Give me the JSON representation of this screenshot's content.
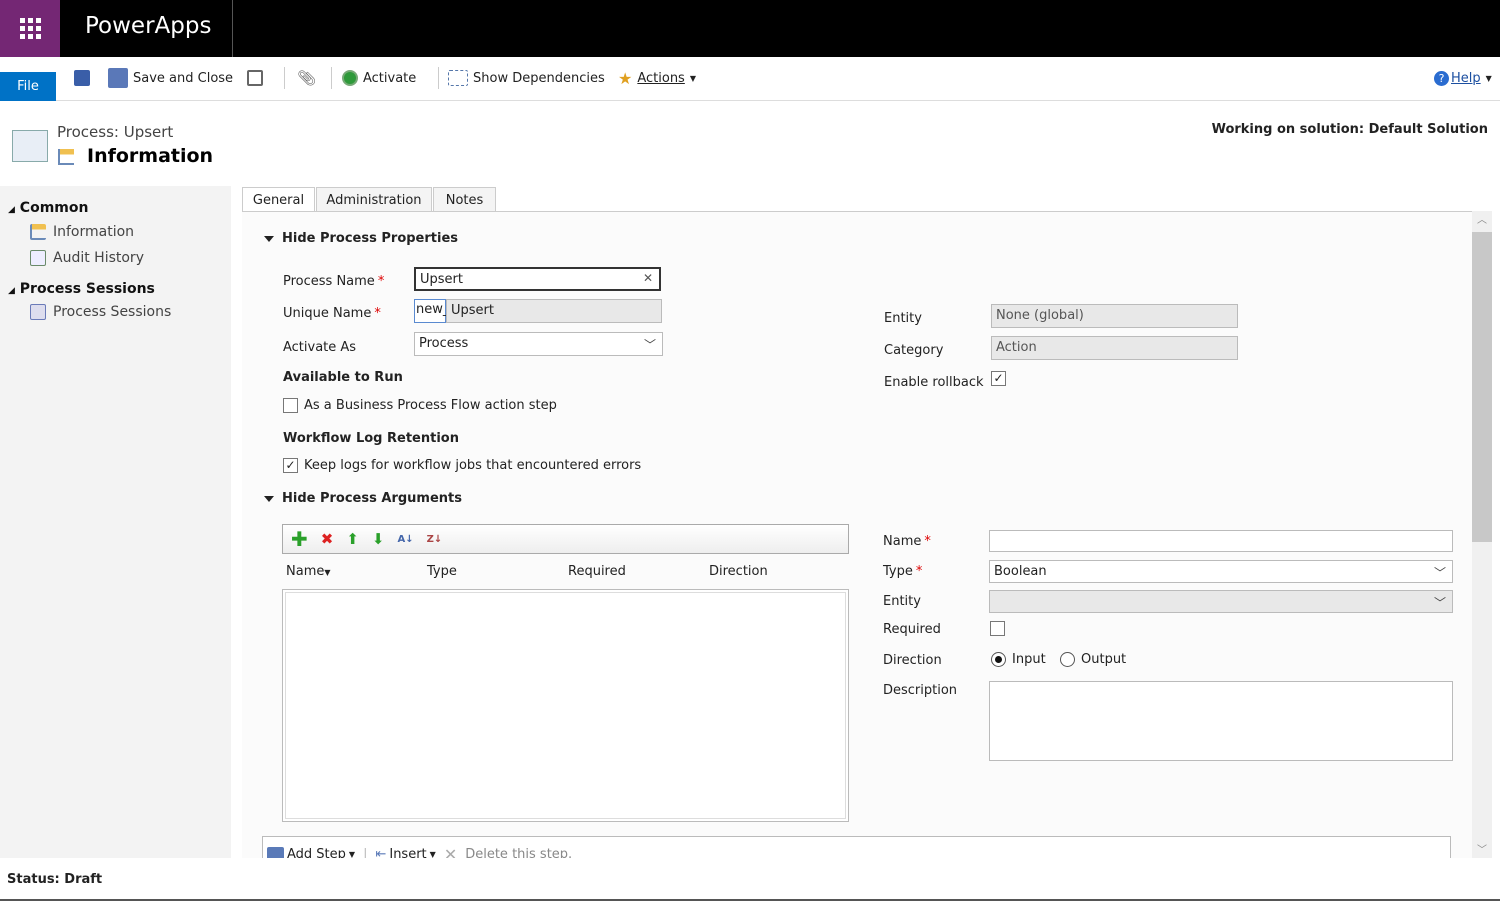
{
  "app": {
    "name": "PowerApps"
  },
  "toolbar": {
    "file": "File",
    "save_close": "Save and Close",
    "activate": "Activate",
    "show_dependencies": "Show Dependencies",
    "actions": "Actions",
    "help": "Help"
  },
  "header": {
    "process_label": "Process: Upsert",
    "title": "Information",
    "solution": "Working on solution: Default Solution"
  },
  "sidebar": {
    "sections": [
      {
        "label": "Common",
        "items": [
          {
            "label": "Information"
          },
          {
            "label": "Audit History"
          }
        ]
      },
      {
        "label": "Process Sessions",
        "items": [
          {
            "label": "Process Sessions"
          }
        ]
      }
    ]
  },
  "tabs": [
    {
      "label": "General",
      "active": true
    },
    {
      "label": "Administration"
    },
    {
      "label": "Notes"
    }
  ],
  "properties": {
    "section": "Hide Process Properties",
    "process_name_label": "Process Name",
    "process_name": "Upsert",
    "unique_name_label": "Unique Name",
    "unique_prefix": "new_",
    "unique_name": "Upsert",
    "activate_as_label": "Activate As",
    "activate_as": "Process",
    "available_heading": "Available to Run",
    "bpf_label": "As a Business Process Flow action step",
    "bpf_checked": false,
    "log_heading": "Workflow Log Retention",
    "log_label": "Keep logs for workflow jobs that encountered errors",
    "log_checked": true,
    "entity_label": "Entity",
    "entity": "None (global)",
    "category_label": "Category",
    "category": "Action",
    "rollback_label": "Enable rollback",
    "rollback_checked": true
  },
  "arguments": {
    "section": "Hide Process Arguments",
    "columns": [
      "Name",
      "Type",
      "Required",
      "Direction"
    ],
    "rows": [],
    "name_label": "Name",
    "name_value": "",
    "type_label": "Type",
    "type_value": "Boolean",
    "entity_label": "Entity",
    "entity_value": "",
    "required_label": "Required",
    "required_checked": false,
    "direction_label": "Direction",
    "direction_options": [
      "Input",
      "Output"
    ],
    "direction_selected": "Input",
    "description_label": "Description",
    "description_value": ""
  },
  "steps": {
    "add_step": "Add Step",
    "insert": "Insert",
    "delete": "Delete this step."
  },
  "status": {
    "text": "Status: Draft"
  }
}
